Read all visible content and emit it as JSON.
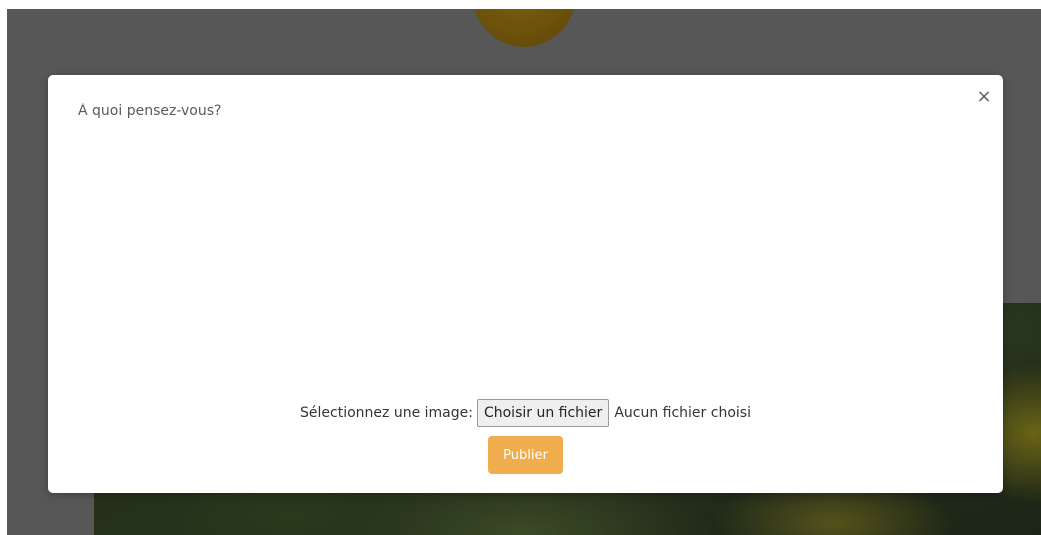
{
  "modal": {
    "close_label": "×",
    "textarea_placeholder": "À quoi pensez-vous?",
    "textarea_value": "",
    "file_input": {
      "label": "Sélectionnez une image:",
      "button_label": "Choisir un fichier",
      "status": "Aucun fichier choisi"
    },
    "publish_label": "Publier"
  },
  "colors": {
    "backdrop": "#575757",
    "publish_button": "#f0ad4e",
    "modal_background": "#ffffff"
  },
  "icons": {
    "close": "close-icon"
  }
}
